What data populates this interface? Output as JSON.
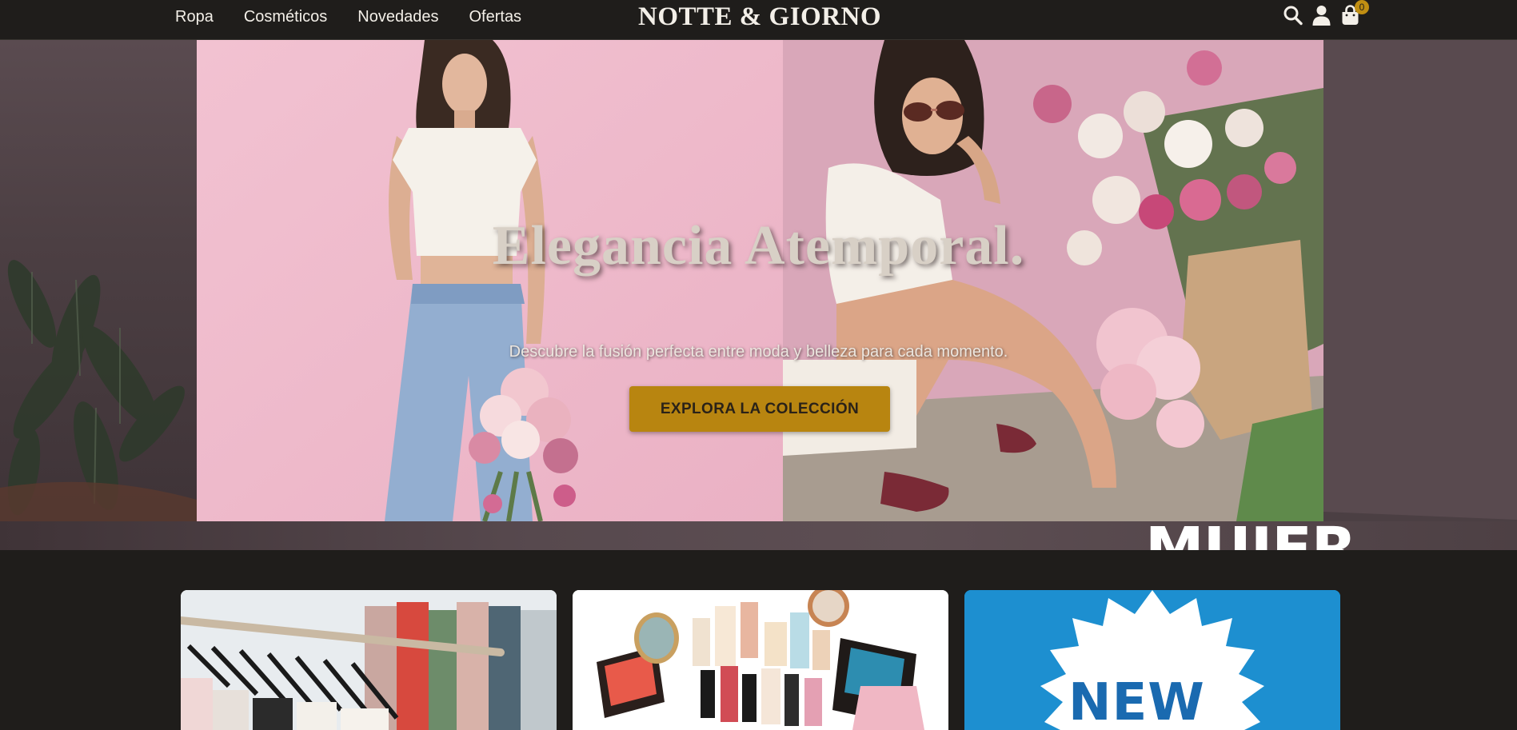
{
  "nav": {
    "links": [
      {
        "label": "Ropa"
      },
      {
        "label": "Cosméticos"
      },
      {
        "label": "Novedades"
      },
      {
        "label": "Ofertas"
      }
    ],
    "brand": "NOTTE & GIORNO",
    "icons": [
      "search-icon",
      "user-icon",
      "shopping-bag-icon"
    ],
    "cart_count": "0"
  },
  "hero": {
    "title": "Elegancia Atemporal.",
    "subtitle": "Descubre la fusión perfecta entre moda y belleza para cada momento.",
    "cta_label": "EXPLORA LA COLECCIÓN",
    "banner_word": "MUJER"
  },
  "cards": {
    "novedades_badge": "NEW"
  },
  "colors": {
    "background": "#1f1d1b",
    "accent": "#b88510",
    "nav_text": "#f3efe8",
    "hero_pink": "#eeb7c9",
    "new_blue": "#1d8fd0"
  }
}
